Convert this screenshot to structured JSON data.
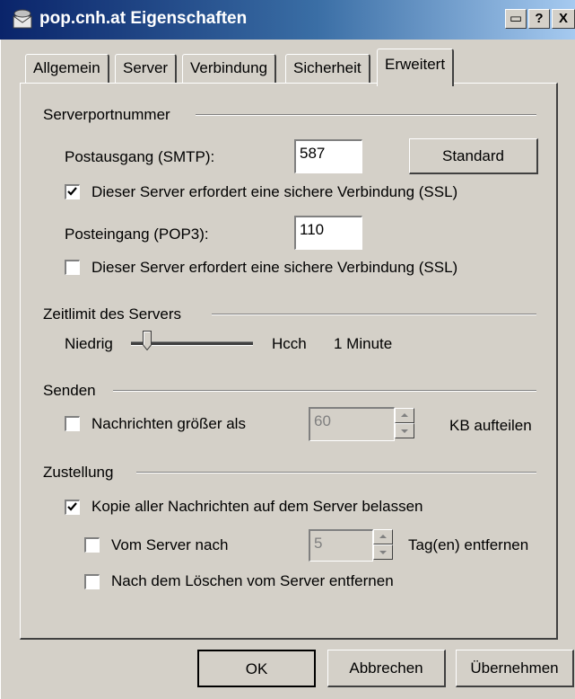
{
  "window": {
    "title": "pop.cnh.at Eigenschaften"
  },
  "title_buttons": {
    "restore": "▭",
    "help": "?",
    "close": "X"
  },
  "tabs": [
    {
      "label": "Allgemein",
      "active": false
    },
    {
      "label": "Server",
      "active": false
    },
    {
      "label": "Verbindung",
      "active": false
    },
    {
      "label": "Sicherheit",
      "active": false
    },
    {
      "label": "Erweitert",
      "active": true
    }
  ],
  "serverport": {
    "group_label": "Serverportnummer",
    "smtp_label": "Postausgang (SMTP):",
    "smtp_value": "587",
    "standard_button": "Standard",
    "smtp_ssl_label": "Dieser Server erfordert eine sichere Verbindung (SSL)",
    "smtp_ssl_checked": true,
    "pop3_label": "Posteingang (POP3):",
    "pop3_value": "110",
    "pop3_ssl_label": "Dieser Server erfordert eine sichere Verbindung (SSL)",
    "pop3_ssl_checked": false
  },
  "timeout": {
    "group_label": "Zeitlimit des Servers",
    "low_label": "Niedrig",
    "high_label": "Hcch",
    "value_label": "1 Minute",
    "level": 0.13
  },
  "send": {
    "group_label": "Senden",
    "split_label": "Nachrichten größer als",
    "split_checked": false,
    "split_value": "60",
    "unit_label": "KB aufteilen"
  },
  "delivery": {
    "group_label": "Zustellung",
    "keep_label": "Kopie aller Nachrichten auf dem Server belassen",
    "keep_checked": true,
    "remove_after_label": "Vom Server nach",
    "remove_after_checked": false,
    "remove_after_value": "5",
    "days_label": "Tag(en) entfernen",
    "remove_on_delete_label": "Nach dem Löschen vom Server entfernen",
    "remove_on_delete_checked": false
  },
  "buttons": {
    "ok": "OK",
    "cancel": "Abbrechen",
    "apply": "Übernehmen"
  },
  "colors": {
    "titlebar_start": "#0a246a",
    "titlebar_end": "#a6caf0",
    "face": "#d4d0c8"
  }
}
